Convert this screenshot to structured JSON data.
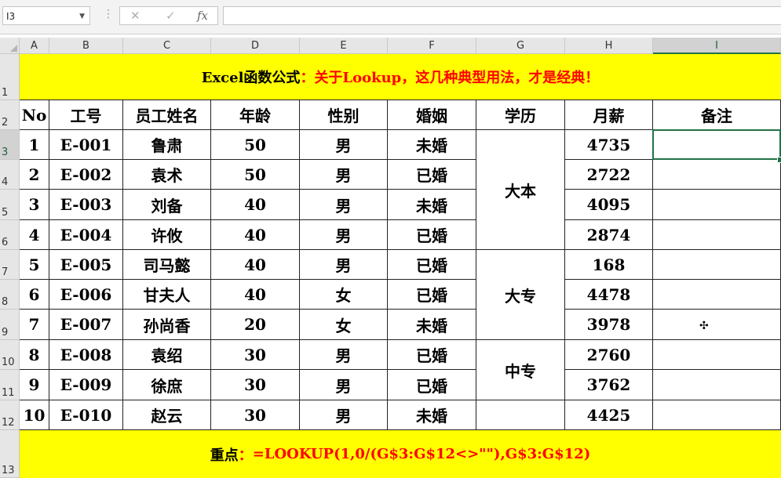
{
  "formula_bar": {
    "name_box": "I3",
    "formula": "",
    "fx_label": "fx"
  },
  "columns": [
    "A",
    "B",
    "C",
    "D",
    "E",
    "F",
    "G",
    "H",
    "I"
  ],
  "selected_column": "I",
  "rows": [
    "1",
    "2",
    "3",
    "4",
    "5",
    "6",
    "7",
    "8",
    "9",
    "10",
    "11",
    "12",
    "13"
  ],
  "sheet": {
    "title_prefix": "Excel函数公式",
    "title_sep": "：",
    "title_main": "关于Lookup，这几种典型用法，才是经典！",
    "headers": [
      "No",
      "工号",
      "员工姓名",
      "年龄",
      "性别",
      "婚姻",
      "学历",
      "月薪",
      "备注"
    ],
    "records": [
      {
        "no": "1",
        "id": "E-001",
        "name": "鲁肃",
        "age": "50",
        "gender": "男",
        "marriage": "未婚",
        "salary": "4735"
      },
      {
        "no": "2",
        "id": "E-002",
        "name": "袁术",
        "age": "50",
        "gender": "男",
        "marriage": "已婚",
        "salary": "2722"
      },
      {
        "no": "3",
        "id": "E-003",
        "name": "刘备",
        "age": "40",
        "gender": "男",
        "marriage": "未婚",
        "salary": "4095"
      },
      {
        "no": "4",
        "id": "E-004",
        "name": "许攸",
        "age": "40",
        "gender": "男",
        "marriage": "已婚",
        "salary": "2874"
      },
      {
        "no": "5",
        "id": "E-005",
        "name": "司马懿",
        "age": "40",
        "gender": "男",
        "marriage": "已婚",
        "salary": "168"
      },
      {
        "no": "6",
        "id": "E-006",
        "name": "甘夫人",
        "age": "40",
        "gender": "女",
        "marriage": "已婚",
        "salary": "4478"
      },
      {
        "no": "7",
        "id": "E-007",
        "name": "孙尚香",
        "age": "20",
        "gender": "女",
        "marriage": "未婚",
        "salary": "3978"
      },
      {
        "no": "8",
        "id": "E-008",
        "name": "袁绍",
        "age": "30",
        "gender": "男",
        "marriage": "已婚",
        "salary": "2760"
      },
      {
        "no": "9",
        "id": "E-009",
        "name": "徐庶",
        "age": "30",
        "gender": "男",
        "marriage": "已婚",
        "salary": "3762"
      },
      {
        "no": "10",
        "id": "E-010",
        "name": "赵云",
        "age": "30",
        "gender": "男",
        "marriage": "未婚",
        "salary": "4425"
      }
    ],
    "education_groups": [
      {
        "label": "大本",
        "rows": 4
      },
      {
        "label": "大专",
        "rows": 3
      },
      {
        "label": "中专",
        "rows": 2
      },
      {
        "label": "",
        "rows": 1
      }
    ],
    "footer_label": "重点",
    "footer_sep": "：",
    "footer_formula": "=LOOKUP(1,0/(G$3:G$12<>\"\"),G$3:G$12)"
  },
  "colors": {
    "band_yellow": "#ffff00",
    "title_red": "#ff0000",
    "selection_green": "#217346"
  },
  "icons": {
    "cancel": "cancel-icon",
    "enter": "enter-icon",
    "function": "fx-icon",
    "cursor": "cell-cursor-icon"
  }
}
